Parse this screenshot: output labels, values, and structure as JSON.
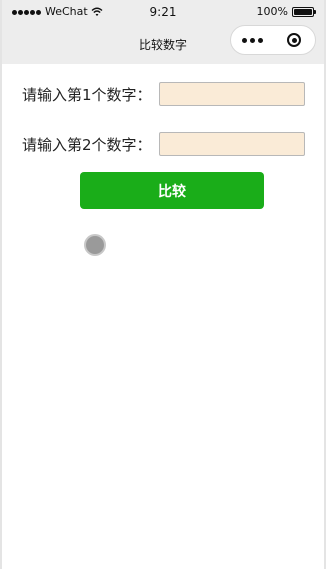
{
  "status_bar": {
    "carrier": "WeChat",
    "time": "9:21",
    "battery": "100%"
  },
  "nav": {
    "title": "比较数字"
  },
  "form": {
    "field1_label": "请输入第1个数字：",
    "field1_value": "",
    "field2_label": "请输入第2个数字：",
    "field2_value": ""
  },
  "actions": {
    "compare_label": "比较"
  },
  "colors": {
    "button": "#1aad19",
    "input_bg": "#faebd7",
    "nav_bg": "#ededed"
  }
}
